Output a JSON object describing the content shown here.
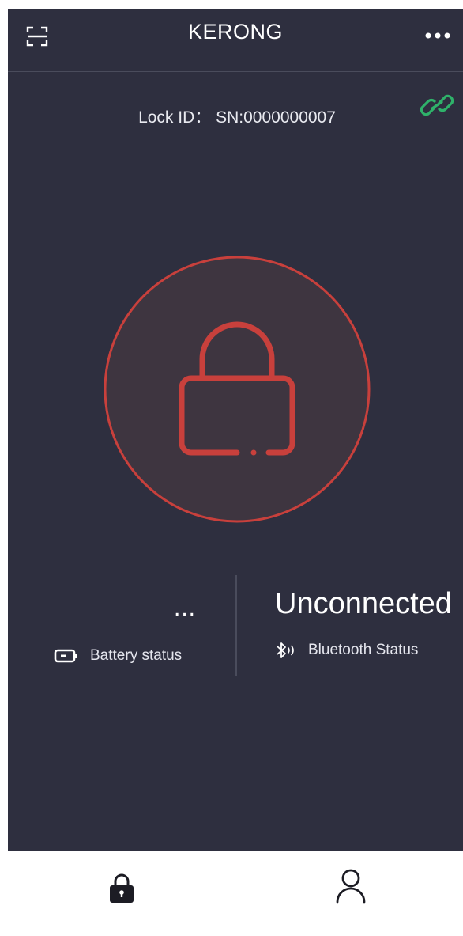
{
  "header": {
    "title": "KERONG",
    "left_icon": "scan-icon",
    "right_icon": "more-icon"
  },
  "lock_info": {
    "id_label": "Lock ID：",
    "id_value": "SN:0000000007",
    "link_icon": "link-icon"
  },
  "lock_button": {
    "icon": "lock-icon",
    "state": "locked"
  },
  "battery": {
    "value": "...",
    "label": "Battery status",
    "icon": "battery-icon"
  },
  "bluetooth": {
    "value": "Unconnected",
    "label": "Bluetooth Status",
    "icon": "bluetooth-icon"
  },
  "bottom_nav": {
    "items": [
      {
        "name": "lock",
        "icon": "lock-icon",
        "active": true
      },
      {
        "name": "profile",
        "icon": "user-icon",
        "active": false
      }
    ]
  },
  "colors": {
    "background": "#2e2f3f",
    "lock_red": "#c8403c",
    "lock_fill": "#3e3540",
    "link_green": "#2fb26a",
    "nav_bg": "#ffffff"
  }
}
